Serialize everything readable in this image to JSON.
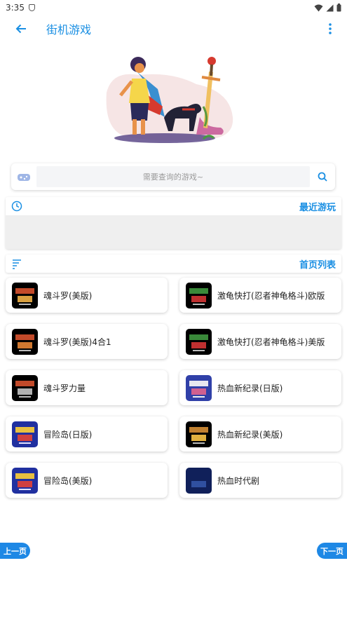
{
  "status": {
    "time": "3:35"
  },
  "app_bar": {
    "title": "街机游戏"
  },
  "search": {
    "placeholder": "需要查询的游戏~"
  },
  "recent": {
    "label": "最近游玩"
  },
  "home_list": {
    "label": "首页列表"
  },
  "games": [
    {
      "name": "魂斗罗(美版)",
      "thumb": "contra"
    },
    {
      "name": "激龟快打(忍者神龟格斗)欧版",
      "thumb": "tmnt"
    },
    {
      "name": "魂斗罗(美版)4合1",
      "thumb": "contra-4in1"
    },
    {
      "name": "激龟快打(忍者神龟格斗)美版",
      "thumb": "tmnt"
    },
    {
      "name": "魂斗罗力量",
      "thumb": "contra-force"
    },
    {
      "name": "热血新纪录(日版)",
      "thumb": "nekketsu-jp"
    },
    {
      "name": "冒险岛(日版)",
      "thumb": "adventure-island"
    },
    {
      "name": "热血新纪录(美版)",
      "thumb": "nekketsu-us"
    },
    {
      "name": "冒险岛(美版)",
      "thumb": "adventure-island"
    },
    {
      "name": "热血时代剧",
      "thumb": "jidaigeki"
    }
  ],
  "pagination": {
    "prev": "上一页",
    "next": "下一页"
  },
  "colors": {
    "accent": "#1a8fe3",
    "button": "#1e88e5"
  },
  "icons": [
    "arrow-back-icon",
    "more-vert-icon",
    "gamepad-icon",
    "search-icon",
    "clock-icon",
    "list-icon",
    "wifi-icon",
    "signal-icon",
    "battery-icon",
    "shield-icon"
  ]
}
